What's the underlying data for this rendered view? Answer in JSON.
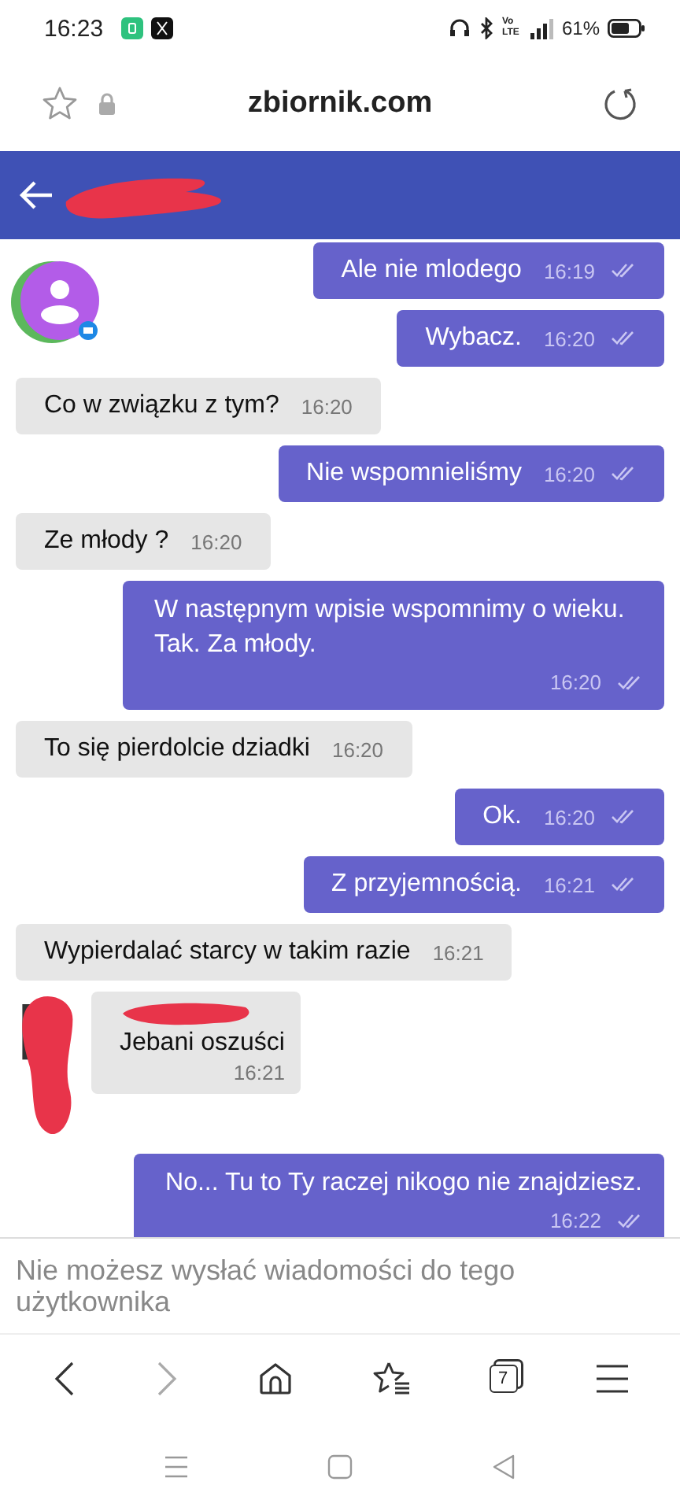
{
  "status_bar": {
    "time": "16:23",
    "battery": "61%",
    "volte": "Vo LTE"
  },
  "address_bar": {
    "url": "zbiornik.com"
  },
  "messages": [
    {
      "kind": "sent",
      "text": "Ale nie mlodego",
      "time": "16:19",
      "read": true
    },
    {
      "kind": "sent",
      "text": "Wybacz.",
      "time": "16:20",
      "read": true
    },
    {
      "kind": "received",
      "text": "Co w związku z tym?",
      "time": "16:20"
    },
    {
      "kind": "sent",
      "text": "Nie wspomnieliśmy",
      "time": "16:20",
      "read": true
    },
    {
      "kind": "received",
      "text": "Ze młody ?",
      "time": "16:20"
    },
    {
      "kind": "sent",
      "text": "W następnym wpisie wspomnimy o wieku. Tak. Za młody.",
      "time": "16:20",
      "read": true,
      "multiline": true
    },
    {
      "kind": "received",
      "text": "To się pierdolcie dziadki",
      "time": "16:20"
    },
    {
      "kind": "sent",
      "text": "Ok.",
      "time": "16:20",
      "read": true
    },
    {
      "kind": "sent",
      "text": "Z przyjemnością.",
      "time": "16:21",
      "read": true
    },
    {
      "kind": "received",
      "text": "Wypierdalać starcy w takim razie",
      "time": "16:21"
    },
    {
      "kind": "received_group",
      "text": "Jebani oszuści",
      "time": "16:21"
    },
    {
      "kind": "sent",
      "text": "No... Tu to Ty raczej nikogo nie znajdziesz.",
      "time": "16:22",
      "read": true,
      "multiline": true
    }
  ],
  "notice": "Nie możesz wysłać wiadomości do tego użytkownika",
  "browser_nav": {
    "tab_count": "7"
  }
}
